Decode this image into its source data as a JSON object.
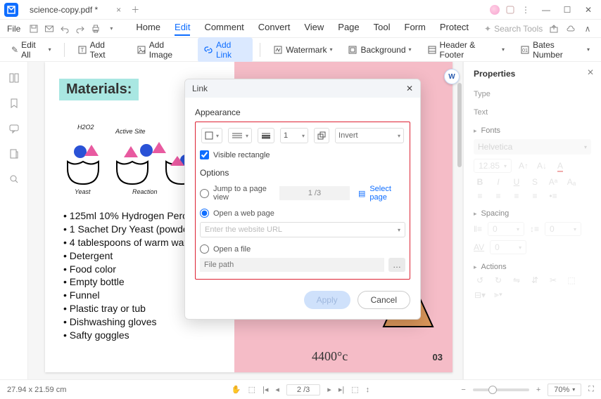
{
  "titlebar": {
    "tab_title": "science-copy.pdf *"
  },
  "filerow": {
    "file": "File",
    "search_placeholder": "Search Tools"
  },
  "menu": {
    "home": "Home",
    "edit": "Edit",
    "comment": "Comment",
    "convert": "Convert",
    "view": "View",
    "page": "Page",
    "tool": "Tool",
    "form": "Form",
    "protect": "Protect"
  },
  "toolbar": {
    "edit_all": "Edit All",
    "add_text": "Add Text",
    "add_image": "Add Image",
    "add_link": "Add Link",
    "watermark": "Watermark",
    "background": "Background",
    "header_footer": "Header & Footer",
    "bates": "Bates Number"
  },
  "document": {
    "materials_heading": "Materials:",
    "labels": {
      "h2o2": "H2O2",
      "active_site": "Active Site",
      "yeast": "Yeast",
      "reaction": "Reaction"
    },
    "materials_list": [
      "125ml 10% Hydrogen Pero",
      "1 Sachet Dry Yeast (powder",
      "4 tablespoons of warm wat",
      "Detergent",
      "Food color",
      "Empty bottle",
      "Funnel",
      "Plastic tray or tub",
      "Dishwashing gloves",
      "Safty goggles"
    ],
    "temperature": "4400°c",
    "page_number": "03",
    "word_badge": "W"
  },
  "dialog": {
    "title": "Link",
    "appearance_label": "Appearance",
    "thickness_value": "1",
    "invert_label": "Invert",
    "visible_rect": "Visible rectangle",
    "options_label": "Options",
    "jump_label": "Jump to a page view",
    "jump_page": "1 /3",
    "select_page": "Select page",
    "open_web": "Open a web page",
    "url_placeholder": "Enter the website URL",
    "open_file": "Open a file",
    "file_placeholder": "File path",
    "apply": "Apply",
    "cancel": "Cancel"
  },
  "rpanel": {
    "title": "Properties",
    "type": "Type",
    "text": "Text",
    "fonts": "Fonts",
    "font_name": "Helvetica",
    "font_size": "12.85",
    "spacing": "Spacing",
    "spacing_val": "0",
    "actions": "Actions"
  },
  "statusbar": {
    "dimensions": "27.94 x 21.59 cm",
    "page": "2 /3",
    "zoom": "70%"
  }
}
